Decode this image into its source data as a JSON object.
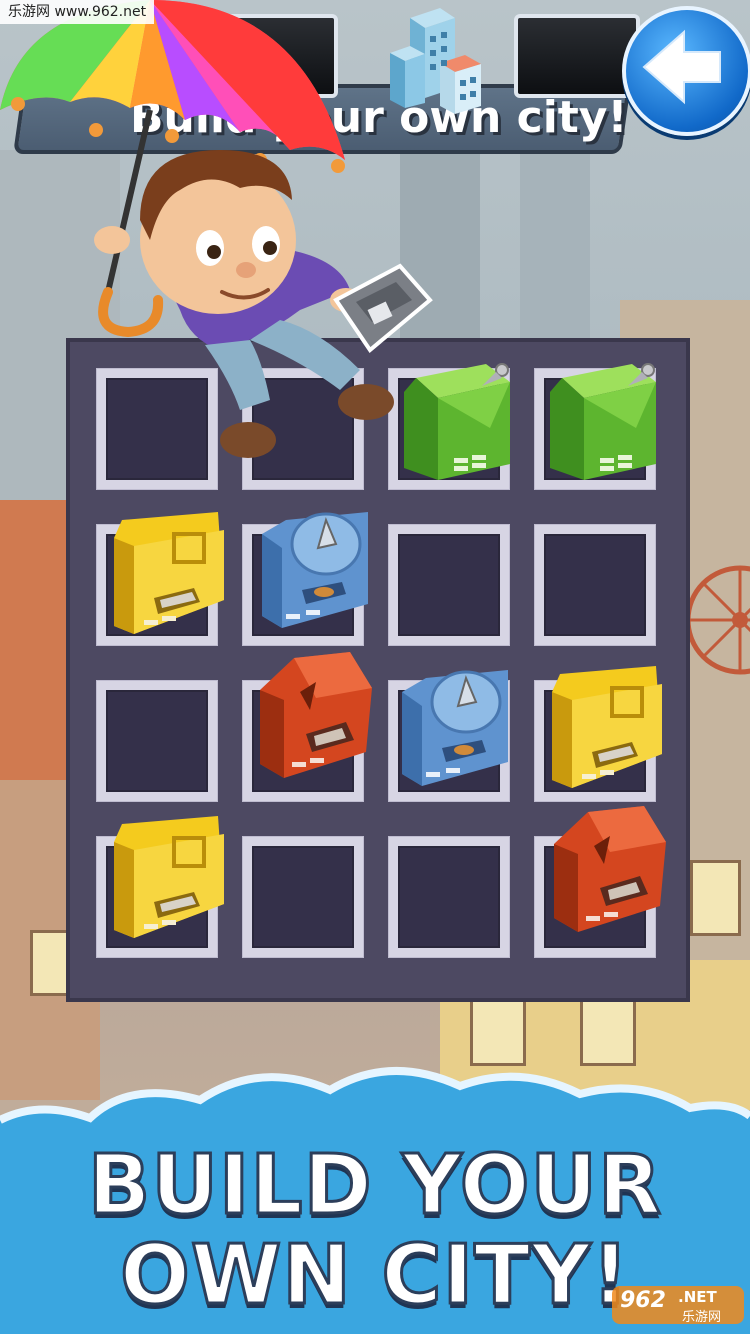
{
  "watermark": {
    "top_text": "乐游网 www.962.net",
    "badge_number": "962",
    "badge_tld": ".NET",
    "badge_cn": "乐游网"
  },
  "hud": {
    "banner_text": "Build your own city!",
    "left_counter": "",
    "right_counter": "",
    "icons": {
      "center": "city-buildings-icon",
      "back": "back-arrow-icon"
    }
  },
  "board": {
    "rows": 4,
    "cols": 4,
    "cells": [
      [
        "empty",
        "empty",
        "green",
        "green"
      ],
      [
        "yellow",
        "blue",
        "empty",
        "empty"
      ],
      [
        "empty",
        "red",
        "blue",
        "yellow"
      ],
      [
        "yellow",
        "empty",
        "empty",
        "red"
      ]
    ]
  },
  "colors": {
    "green": "#5db52f",
    "yellow": "#f4cb1e",
    "blue": "#5f93cf",
    "red": "#d4461f",
    "board": "#4d4962",
    "sky_cloud": "#3aa6e0"
  },
  "headline": {
    "line1": "BUILD YOUR",
    "line2": "OWN CITY!"
  }
}
